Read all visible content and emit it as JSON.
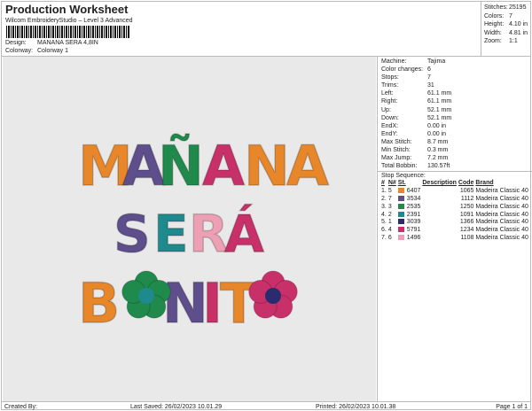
{
  "header": {
    "title": "Production Worksheet",
    "subtitle": "Wilcom EmbroideryStudio – Level 3 Advanced",
    "design_label": "Design:",
    "design_value": "MANANA SERA 4,8IN",
    "colorway_label": "Colorway:",
    "colorway_value": "Colorway 1"
  },
  "stats": [
    {
      "label": "Stitches:",
      "value": "25195"
    },
    {
      "label": "Colors:",
      "value": "7"
    },
    {
      "label": "Height:",
      "value": "4.10 in"
    },
    {
      "label": "Width:",
      "value": "4.81 in"
    },
    {
      "label": "Zoom:",
      "value": "1:1"
    }
  ],
  "info": [
    {
      "label": "Machine:",
      "value": "Tajima"
    },
    {
      "label": "Color changes:",
      "value": "6"
    },
    {
      "label": "Stops:",
      "value": "7"
    },
    {
      "label": "Trims:",
      "value": "31"
    },
    {
      "label": "Left:",
      "value": "61.1 mm"
    },
    {
      "label": "Right:",
      "value": "61.1 mm"
    },
    {
      "label": "Up:",
      "value": "52.1 mm"
    },
    {
      "label": "Down:",
      "value": "52.1 mm"
    },
    {
      "label": "EndX:",
      "value": "0.00 in"
    },
    {
      "label": "EndY:",
      "value": "0.00 in"
    },
    {
      "label": "Max Stitch:",
      "value": "8.7 mm"
    },
    {
      "label": "Min Stitch:",
      "value": "0.3 mm"
    },
    {
      "label": "Max Jump:",
      "value": "7.2 mm"
    },
    {
      "label": "Total Bobbin:",
      "value": "130.57ft"
    }
  ],
  "sequence": {
    "title": "Stop Sequence:",
    "headers": [
      "#",
      "N#",
      "St.",
      "Description",
      "Code",
      "Brand"
    ],
    "rows": [
      {
        "n": "1.",
        "num": "5",
        "color": "#e8862a",
        "st": "6407",
        "code": "1065",
        "brand": "Madeira Classic 40"
      },
      {
        "n": "2.",
        "num": "7",
        "color": "#5e4e8c",
        "st": "3534",
        "code": "1112",
        "brand": "Madeira Classic 40"
      },
      {
        "n": "3.",
        "num": "3",
        "color": "#1f8a4c",
        "st": "2535",
        "code": "1250",
        "brand": "Madeira Classic 40"
      },
      {
        "n": "4.",
        "num": "2",
        "color": "#1e8a8e",
        "st": "2391",
        "code": "1091",
        "brand": "Madeira Classic 40"
      },
      {
        "n": "5.",
        "num": "1",
        "color": "#2a2c6e",
        "st": "3039",
        "code": "1366",
        "brand": "Madeira Classic 40"
      },
      {
        "n": "6.",
        "num": "4",
        "color": "#c8306a",
        "st": "5791",
        "code": "1234",
        "brand": "Madeira Classic 40"
      },
      {
        "n": "7.",
        "num": "6",
        "color": "#eda0b4",
        "st": "1496",
        "code": "1108",
        "brand": "Madeira Classic 40"
      }
    ]
  },
  "design_letters": {
    "line1": [
      "M",
      "A",
      "Ñ",
      "A",
      "N",
      "A"
    ],
    "line2": [
      "S",
      "E",
      "R",
      "Á"
    ],
    "line3": [
      "B",
      "N",
      "I",
      "T"
    ]
  },
  "footer": {
    "created": "Created By:",
    "saved": "Last Saved: 26/02/2023 10.01.29",
    "printed": "Printed: 26/02/2023 10.01.38",
    "page": "Page 1 of 1"
  }
}
